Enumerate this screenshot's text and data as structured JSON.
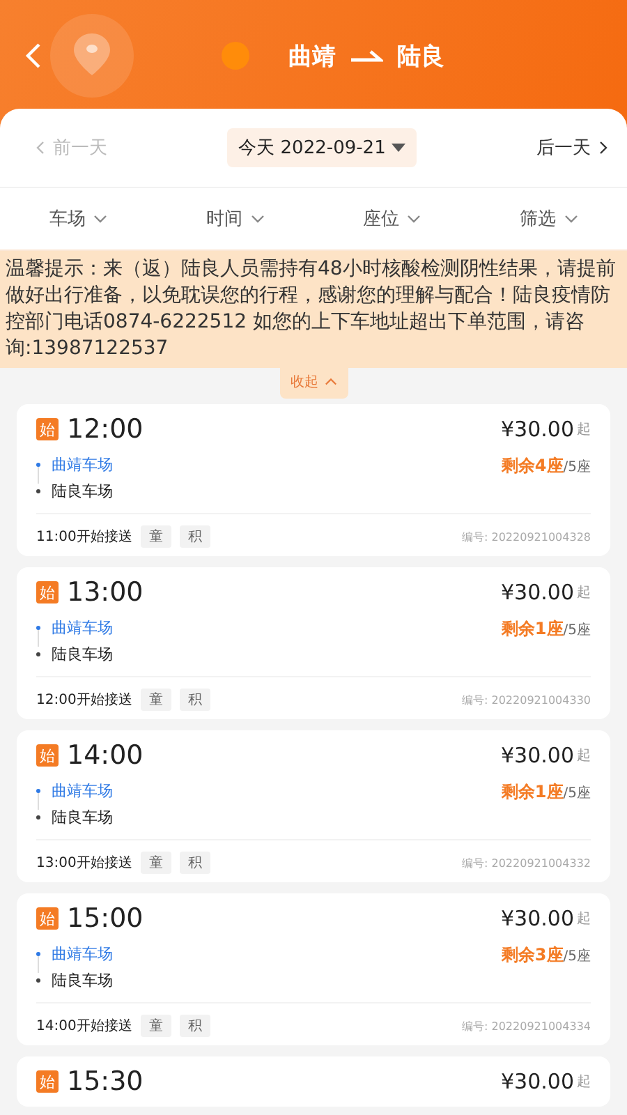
{
  "header": {
    "from": "曲靖",
    "to": "陆良"
  },
  "date_bar": {
    "prev": {
      "label": "前一天",
      "disabled": true
    },
    "current": "今天 2022-09-21",
    "next": {
      "label": "后一天",
      "disabled": false
    }
  },
  "filters": [
    "车场",
    "时间",
    "座位",
    "筛选"
  ],
  "notice": {
    "text": "温馨提示：来（返）陆良人员需持有48小时核酸检测阴性结果，请提前做好出行准备，以免耽误您的行程，感谢您的理解与配合！陆良疫情防控部门电话0874-6222512 如您的上下车地址超出下单范围，请咨询:13987122537",
    "collapse": "收起"
  },
  "trips": [
    {
      "badge": "始",
      "time": "12:00",
      "price": "¥30.00",
      "price_suffix": "起",
      "stops": [
        {
          "name": "曲靖车场",
          "kind": "origin"
        },
        {
          "name": "陆良车场",
          "kind": "destination"
        }
      ],
      "remaining": "剩余4座",
      "capacity": "/5座",
      "pickup": "11:00开始接送",
      "tags": [
        "童",
        "积"
      ],
      "number": "编号: 20220921004328"
    },
    {
      "badge": "始",
      "time": "13:00",
      "price": "¥30.00",
      "price_suffix": "起",
      "stops": [
        {
          "name": "曲靖车场",
          "kind": "origin"
        },
        {
          "name": "陆良车场",
          "kind": "destination"
        }
      ],
      "remaining": "剩余1座",
      "capacity": "/5座",
      "pickup": "12:00开始接送",
      "tags": [
        "童",
        "积"
      ],
      "number": "编号: 20220921004330"
    },
    {
      "badge": "始",
      "time": "14:00",
      "price": "¥30.00",
      "price_suffix": "起",
      "stops": [
        {
          "name": "曲靖车场",
          "kind": "origin"
        },
        {
          "name": "陆良车场",
          "kind": "destination"
        }
      ],
      "remaining": "剩余1座",
      "capacity": "/5座",
      "pickup": "13:00开始接送",
      "tags": [
        "童",
        "积"
      ],
      "number": "编号: 20220921004332"
    },
    {
      "badge": "始",
      "time": "15:00",
      "price": "¥30.00",
      "price_suffix": "起",
      "stops": [
        {
          "name": "曲靖车场",
          "kind": "origin"
        },
        {
          "name": "陆良车场",
          "kind": "destination"
        }
      ],
      "remaining": "剩余3座",
      "capacity": "/5座",
      "pickup": "14:00开始接送",
      "tags": [
        "童",
        "积"
      ],
      "number": "编号: 20220921004334"
    },
    {
      "badge": "始",
      "time": "15:30",
      "price": "¥30.00",
      "price_suffix": "起"
    }
  ]
}
